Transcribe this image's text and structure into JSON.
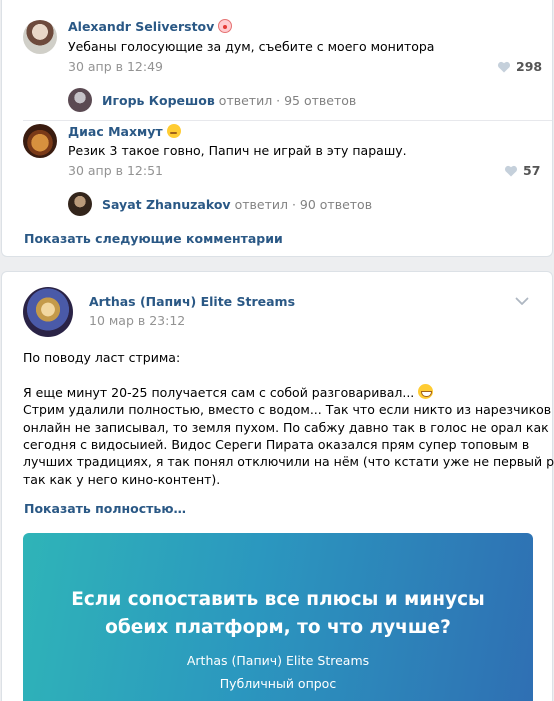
{
  "comments": [
    {
      "author": "Alexandr Seliverstov",
      "emoji": "clown-emoji",
      "text": "Уебаны голосующие за дум, съебите с моего монитора",
      "date": "30 апр в 12:49",
      "likes": "298",
      "reply": {
        "name": "Игорь Корешов",
        "meta": "ответил · 95 ответов"
      }
    },
    {
      "author": "Диас Махмут",
      "emoji": "sly-face-emoji",
      "text": "Резик 3 такое говно, Папич не играй в эту парашу.",
      "date": "30 апр в 12:51",
      "likes": "57",
      "reply": {
        "name": "Sayat Zhanuzakov",
        "meta": "ответил · 90 ответов"
      }
    }
  ],
  "more_comments": "Показать следующие комментарии",
  "post": {
    "author": "Arthas (Папич) Elite Streams",
    "date": "10 мар в 23:12",
    "lines": [
      "По поводу ласт стрима:",
      "",
      "Я еще минут 20-25 получается сам с собой разговаривал...",
      "Стрим удалили полностью, вместо с водом... Так что если никто из нарезчиков",
      "онлайн не записывал, то земля пухом. По сабжу давно так в голос не орал как",
      "сегодня с видосыией. Видос Сереги Пирата оказался прям супер топовым в",
      "лучших традициях, я так понял отключили на нём (что кстати уже не первый раз,",
      "так как у него кино-контент)."
    ],
    "show_full": "Показать полностью…",
    "poll": {
      "question_line1": "Если сопоставить все плюсы и минусы",
      "question_line2": "обеих платформ, то что лучше?",
      "author": "Arthas (Папич) Elite Streams",
      "type": "Публичный опрос"
    }
  },
  "colors": {
    "link": "#2a5885",
    "muted": "#939393",
    "background": "#edeef0",
    "poll_gradient_start": "#2fb4b8",
    "poll_gradient_end": "#2f6fb3"
  },
  "icons": [
    "heart-icon",
    "chevron-down-icon"
  ]
}
